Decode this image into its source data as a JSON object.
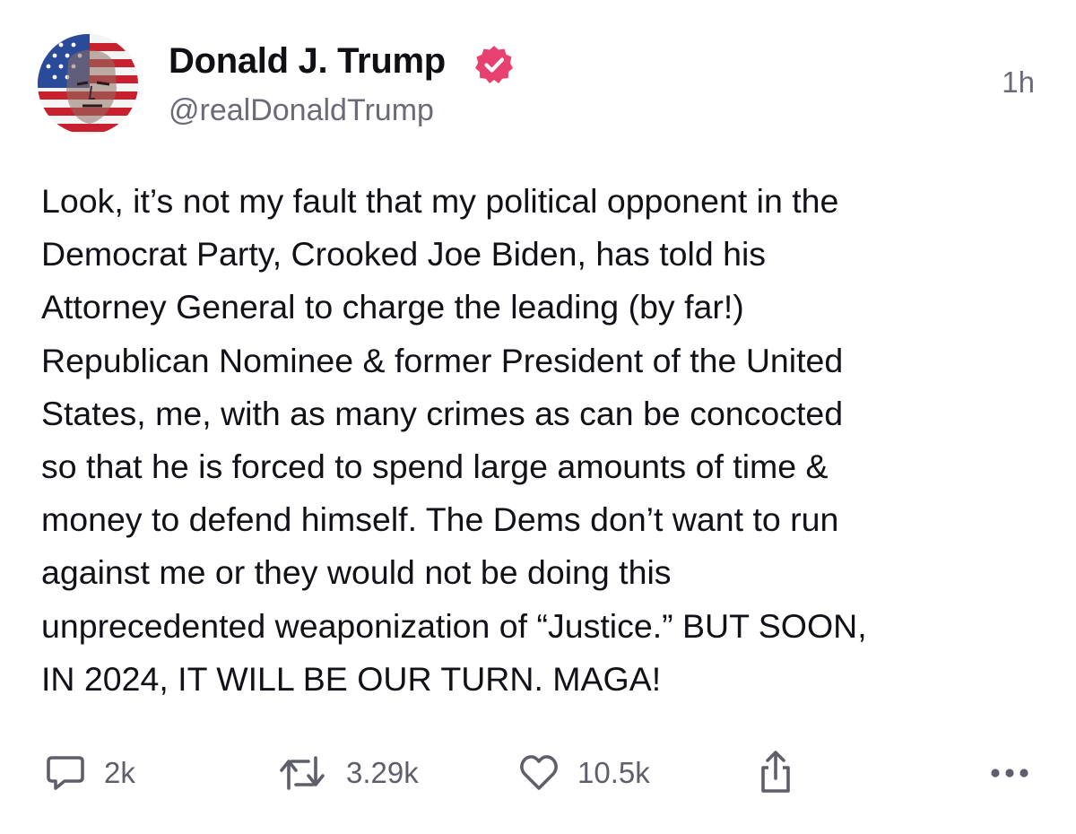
{
  "post": {
    "author": {
      "display_name": "Donald J. Trump",
      "handle": "@realDonaldTrump",
      "verified": true,
      "avatar_icon": "profile-avatar"
    },
    "timestamp": "1h",
    "body_lines": [
      "Look, it’s not my fault that my political opponent in the",
      "Democrat Party, Crooked Joe Biden, has told his",
      "Attorney General to charge the leading (by far!)",
      "Republican Nominee & former President of the United",
      "States, me, with as many crimes as can be concocted",
      "so that he is forced to spend large amounts of time &",
      "money to defend himself. The Dems don’t want to run",
      "against me or they would not be doing this",
      "unprecedented weaponization of “Justice.” BUT SOON,",
      "IN 2024, IT WILL BE OUR TURN. MAGA!"
    ],
    "actions": {
      "reply": {
        "icon": "comment-icon",
        "count": "2k"
      },
      "retruth": {
        "icon": "repost-icon",
        "count": "3.29k"
      },
      "like": {
        "icon": "heart-icon",
        "count": "10.5k"
      },
      "share": {
        "icon": "share-icon"
      },
      "more": {
        "icon": "more-options-icon"
      }
    }
  },
  "colors": {
    "text_primary": "#0f0f14",
    "text_secondary": "#6b6b78",
    "verified_badge": "#e8416f",
    "icon_gray": "#5f5f6b",
    "background": "#ffffff"
  }
}
